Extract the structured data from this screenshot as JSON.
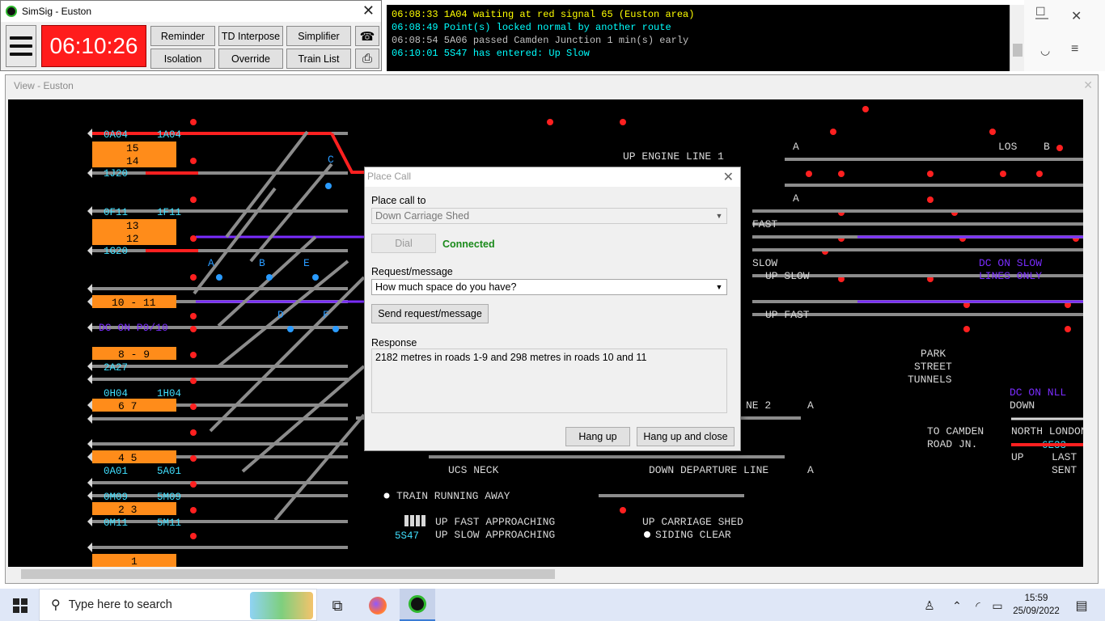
{
  "control_window": {
    "title": "SimSig - Euston",
    "clock": "06:10:26",
    "buttons": {
      "reminder": "Reminder",
      "td_interpose": "TD Interpose",
      "simplifier": "Simplifier",
      "isolation": "Isolation",
      "override": "Override",
      "train_list": "Train List"
    },
    "icons": {
      "phone": "phone-icon",
      "printer": "printer-icon",
      "menu": "hamburger-menu-icon"
    }
  },
  "message_log": [
    {
      "time": "06:08:33",
      "text": "1A04 waiting at red signal 65 (Euston area)",
      "color": "#ffff00"
    },
    {
      "time": "06:08:49",
      "text": "Point(s) locked normal by another route",
      "color": "#00ffff"
    },
    {
      "time": "06:08:54",
      "text": "5A06 passed Camden Junction 1 min(s) early",
      "color": "#c0c0c0"
    },
    {
      "time": "06:10:01",
      "text": "5S47 has entered: Up Slow",
      "color": "#00ffff"
    }
  ],
  "view_window": {
    "title": "View - Euston"
  },
  "diagram": {
    "platform_boxes": [
      "15",
      "14",
      "13",
      "12",
      "10 - 11",
      "8 - 9",
      "6   7",
      "4   5",
      "2   3",
      "1"
    ],
    "berths": [
      "0A04",
      "1A04",
      "1J20",
      "0F11",
      "1F11",
      "1G20",
      "2A27",
      "0H04",
      "1H04",
      "0A01",
      "5A01",
      "0M09",
      "5M09",
      "0M11",
      "5M11",
      "6E33",
      "5S47"
    ],
    "labels": [
      "UP ENGINE LINE 1",
      "FAST",
      "SLOW",
      "UP SLOW",
      "UP FAST",
      "DC ON SLOW",
      "LINES ONLY",
      "PARK",
      "STREET",
      "TUNNELS",
      "DC ON NLL",
      "DOWN",
      "TO CAMDEN",
      "ROAD JN.",
      "NORTH LONDON",
      "UP",
      "LAST",
      "SENT",
      "UCS NECK",
      "DOWN DEPARTURE LINE",
      "TRAIN RUNNING AWAY",
      "UP FAST APPROACHING",
      "UP SLOW APPROACHING",
      "UP CARRIAGE SHED",
      "SIDING CLEAR",
      "DC ON P9/10",
      "LOS",
      "B",
      "A",
      "A",
      "A",
      "A",
      "C",
      "A",
      "B",
      "E",
      "D",
      "F",
      "NE 2"
    ]
  },
  "dialog": {
    "title": "Place Call",
    "place_call_to_label": "Place call to",
    "place_call_to_value": "Down Carriage Shed",
    "dial_label": "Dial",
    "status": "Connected",
    "request_label": "Request/message",
    "request_value": "How much space do you have?",
    "send_label": "Send request/message",
    "response_label": "Response",
    "response_text": "2182 metres in roads 1-9 and 298 metres in roads 10 and 11",
    "hangup_label": "Hang up",
    "hangup_close_label": "Hang up and close"
  },
  "taskbar": {
    "search_placeholder": "Type here to search",
    "time": "15:59",
    "date": "25/09/2022"
  }
}
